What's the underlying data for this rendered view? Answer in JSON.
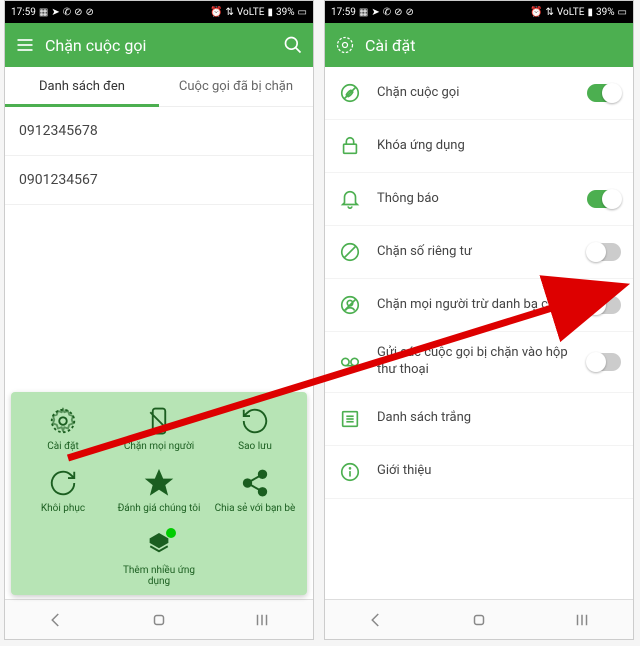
{
  "statusbar": {
    "time": "17:59",
    "battery": "39%",
    "lte_label": "VoLTE"
  },
  "left": {
    "appbar_title": "Chặn cuộc gọi",
    "tabs": {
      "blacklist": "Danh sách đen",
      "blocked": "Cuộc gọi đã bị chặn"
    },
    "numbers": [
      "0912345678",
      "0901234567"
    ],
    "menu": {
      "settings": "Cài đặt",
      "block_all": "Chặn mọi người",
      "backup": "Sao lưu",
      "restore": "Khôi phục",
      "rate": "Đánh giá chúng tôi",
      "share": "Chia sẻ với bạn bè",
      "more_apps": "Thêm nhiều ứng dụng"
    }
  },
  "right": {
    "appbar_title": "Cài đặt",
    "items": {
      "block_calls": "Chặn cuộc gọi",
      "app_lock": "Khóa ứng dụng",
      "notifications": "Thông báo",
      "block_private": "Chặn số riêng tư",
      "block_except_contacts": "Chặn mọi người trừ danh bạ của tôi",
      "voicemail": "Gửi các cuộc gọi bị chặn vào hộp thư thoại",
      "whitelist": "Danh sách trắng",
      "about": "Giới thiệu"
    }
  }
}
